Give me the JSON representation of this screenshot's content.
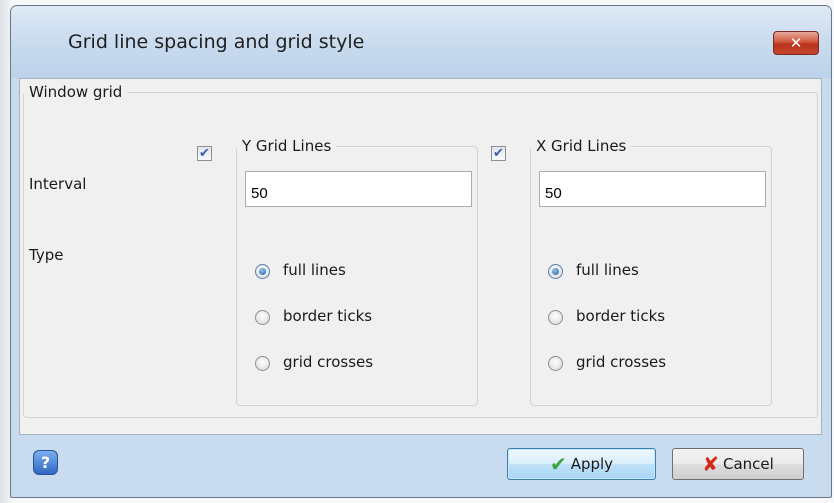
{
  "dialog": {
    "title": "Grid line spacing and grid style",
    "close_glyph": "✕"
  },
  "window_grid": {
    "legend": "Window grid",
    "interval_label": "Interval",
    "type_label": "Type"
  },
  "y_grid": {
    "checkbox_checked": true,
    "legend": "Y Grid Lines",
    "interval_value": "50",
    "selected_type": "full lines",
    "options": [
      "full lines",
      "border ticks",
      "grid crosses"
    ]
  },
  "x_grid": {
    "checkbox_checked": true,
    "legend": "X Grid Lines",
    "interval_value": "50",
    "selected_type": "full lines",
    "options": [
      "full lines",
      "border ticks",
      "grid crosses"
    ]
  },
  "footer": {
    "help_glyph": "?",
    "apply_label": "Apply",
    "cancel_label": "Cancel"
  },
  "icons": {
    "close": "close-icon",
    "check": "checkmark-icon",
    "cancel": "red-x-icon",
    "help": "help-icon"
  }
}
